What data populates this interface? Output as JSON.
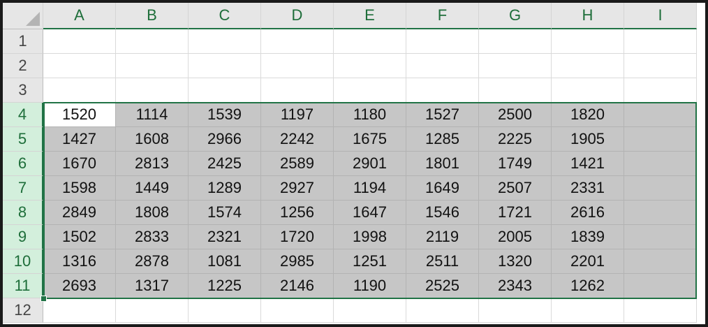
{
  "columns": [
    "A",
    "B",
    "C",
    "D",
    "E",
    "F",
    "G",
    "H",
    "I"
  ],
  "rows": [
    "1",
    "2",
    "3",
    "4",
    "5",
    "6",
    "7",
    "8",
    "9",
    "10",
    "11",
    "12"
  ],
  "cells": {
    "4": [
      "1520",
      "1114",
      "1539",
      "1197",
      "1180",
      "1527",
      "2500",
      "1820",
      ""
    ],
    "5": [
      "1427",
      "1608",
      "2966",
      "2242",
      "1675",
      "1285",
      "2225",
      "1905",
      ""
    ],
    "6": [
      "1670",
      "2813",
      "2425",
      "2589",
      "2901",
      "1801",
      "1749",
      "1421",
      ""
    ],
    "7": [
      "1598",
      "1449",
      "1289",
      "2927",
      "1194",
      "1649",
      "2507",
      "2331",
      ""
    ],
    "8": [
      "2849",
      "1808",
      "1574",
      "1256",
      "1647",
      "1546",
      "1721",
      "2616",
      ""
    ],
    "9": [
      "1502",
      "2833",
      "2321",
      "1720",
      "1998",
      "2119",
      "2005",
      "1839",
      ""
    ],
    "10": [
      "1316",
      "2878",
      "1081",
      "2985",
      "1251",
      "2511",
      "1320",
      "2201",
      ""
    ],
    "11": [
      "2693",
      "1317",
      "1225",
      "2146",
      "1190",
      "2525",
      "2343",
      "1262",
      ""
    ]
  },
  "selection": {
    "range": "A4:I11",
    "active_cell": "A4",
    "accent_color": "#217346",
    "fill_color": "#c6c6c6"
  }
}
